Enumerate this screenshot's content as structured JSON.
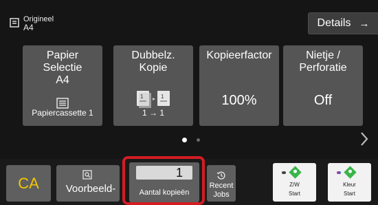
{
  "original": {
    "title": "Origineel",
    "size": "A4"
  },
  "header": {
    "details_label": "Details",
    "details_arrow": "→"
  },
  "tiles": [
    {
      "title_lines": [
        "Papier",
        "Selectie",
        "A4"
      ],
      "value": "Papiercassette 1",
      "icon": "paper-tray-icon"
    },
    {
      "title_lines": [
        "Dubbelz.",
        "Kopie"
      ],
      "value": "1 → 1",
      "icon": "duplex-copy-icon"
    },
    {
      "title_lines": [
        "Kopieerfactor"
      ],
      "value": "100%",
      "icon": ""
    },
    {
      "title_lines": [
        "Nietje /",
        "Perforatie"
      ],
      "value": "Off",
      "icon": ""
    }
  ],
  "pager": {
    "current_page": 1,
    "total_pages": 2
  },
  "bottom": {
    "ca_label": "CA",
    "preview_label": "Voorbeeld-",
    "copies_value": "1",
    "copies_label": "Aantal kopieën",
    "jobs_line1": "Recent",
    "jobs_line2": "Jobs",
    "bw_start_line1": "Z/W",
    "bw_start_line2": "Start",
    "color_start_line1": "Kleur",
    "color_start_line2": "Start"
  },
  "colors": {
    "ca_text": "#f3c600",
    "highlight_frame": "#d41c23",
    "start_diamond": "#39b54a"
  }
}
